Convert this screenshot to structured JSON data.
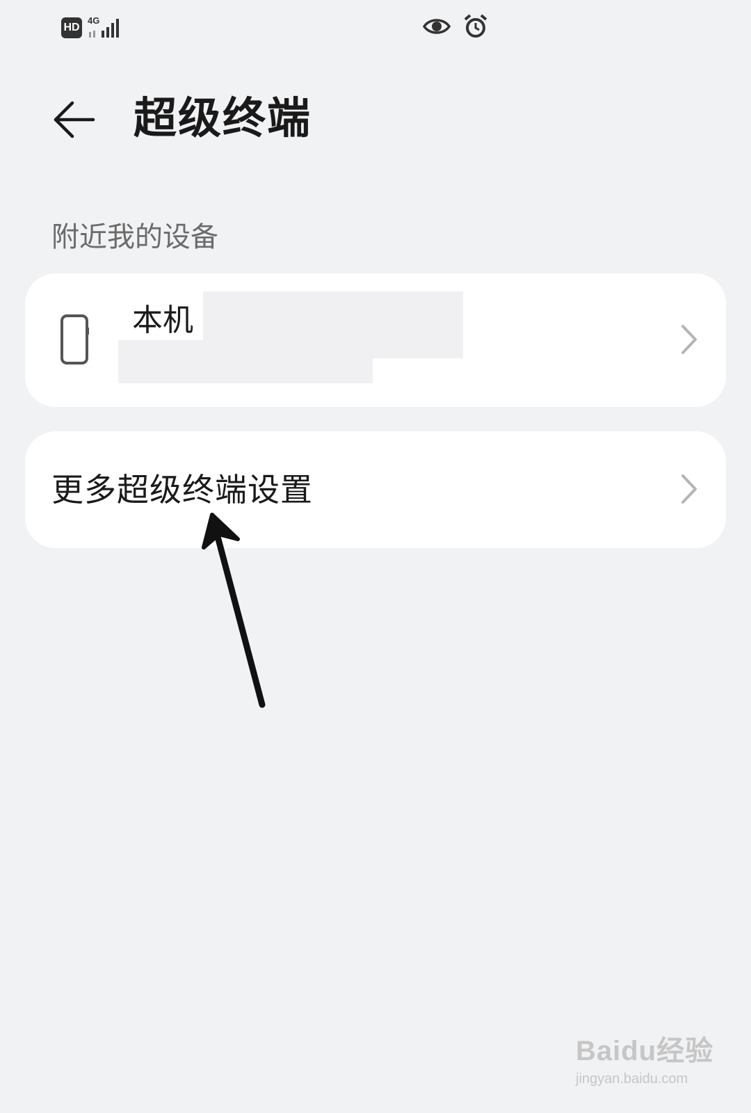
{
  "status_bar": {
    "hd_label": "HD",
    "network_label": "4G",
    "icons": [
      "hd-badge-icon",
      "signal-icon",
      "eye-comfort-icon",
      "alarm-icon"
    ]
  },
  "header": {
    "back_icon": "arrow-left-icon",
    "title": "超级终端"
  },
  "nearby_section": {
    "title": "附近我的设备",
    "device": {
      "icon": "phone-icon",
      "name": "本机"
    }
  },
  "more_settings": {
    "label": "更多超级终端设置",
    "icon": "chevron-right-icon"
  },
  "watermark": {
    "logo": "Baidu经验",
    "url": "jingyan.baidu.com"
  },
  "colors": {
    "background": "#f1f2f4",
    "card": "#ffffff",
    "text_primary": "#1a1a1a",
    "text_secondary": "#6b6b6b",
    "chevron": "#b5b5b5"
  }
}
